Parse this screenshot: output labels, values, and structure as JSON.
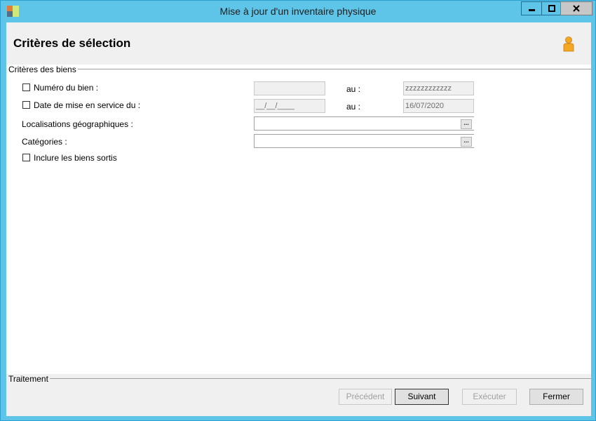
{
  "window": {
    "title": "Mise à jour d'un inventaire physique"
  },
  "header": {
    "title": "Critères de sélection"
  },
  "criteria": {
    "group_title": "Critères des biens",
    "numero": {
      "label": "Numéro du bien :",
      "to_label": "au :",
      "from_value": "",
      "to_value": "zzzzzzzzzzzz"
    },
    "date": {
      "label": "Date de mise en service du :",
      "to_label": "au :",
      "from_value": "__/__/____",
      "to_value": "16/07/2020"
    },
    "localisations": {
      "label": "Localisations géographiques :",
      "value": "",
      "button_label": "..."
    },
    "categories": {
      "label": "Catégories :",
      "value": "",
      "button_label": "..."
    },
    "inclure": {
      "label": "Inclure les biens sortis"
    }
  },
  "traitement": {
    "group_title": "Traitement",
    "buttons": {
      "precedent": "Précédent",
      "suivant": "Suivant",
      "executer": "Exécuter",
      "fermer": "Fermer"
    }
  },
  "colors": {
    "frame": "#5ec4e8",
    "panel": "#f0f0f0",
    "accent_user_icon": "#f5a623"
  }
}
